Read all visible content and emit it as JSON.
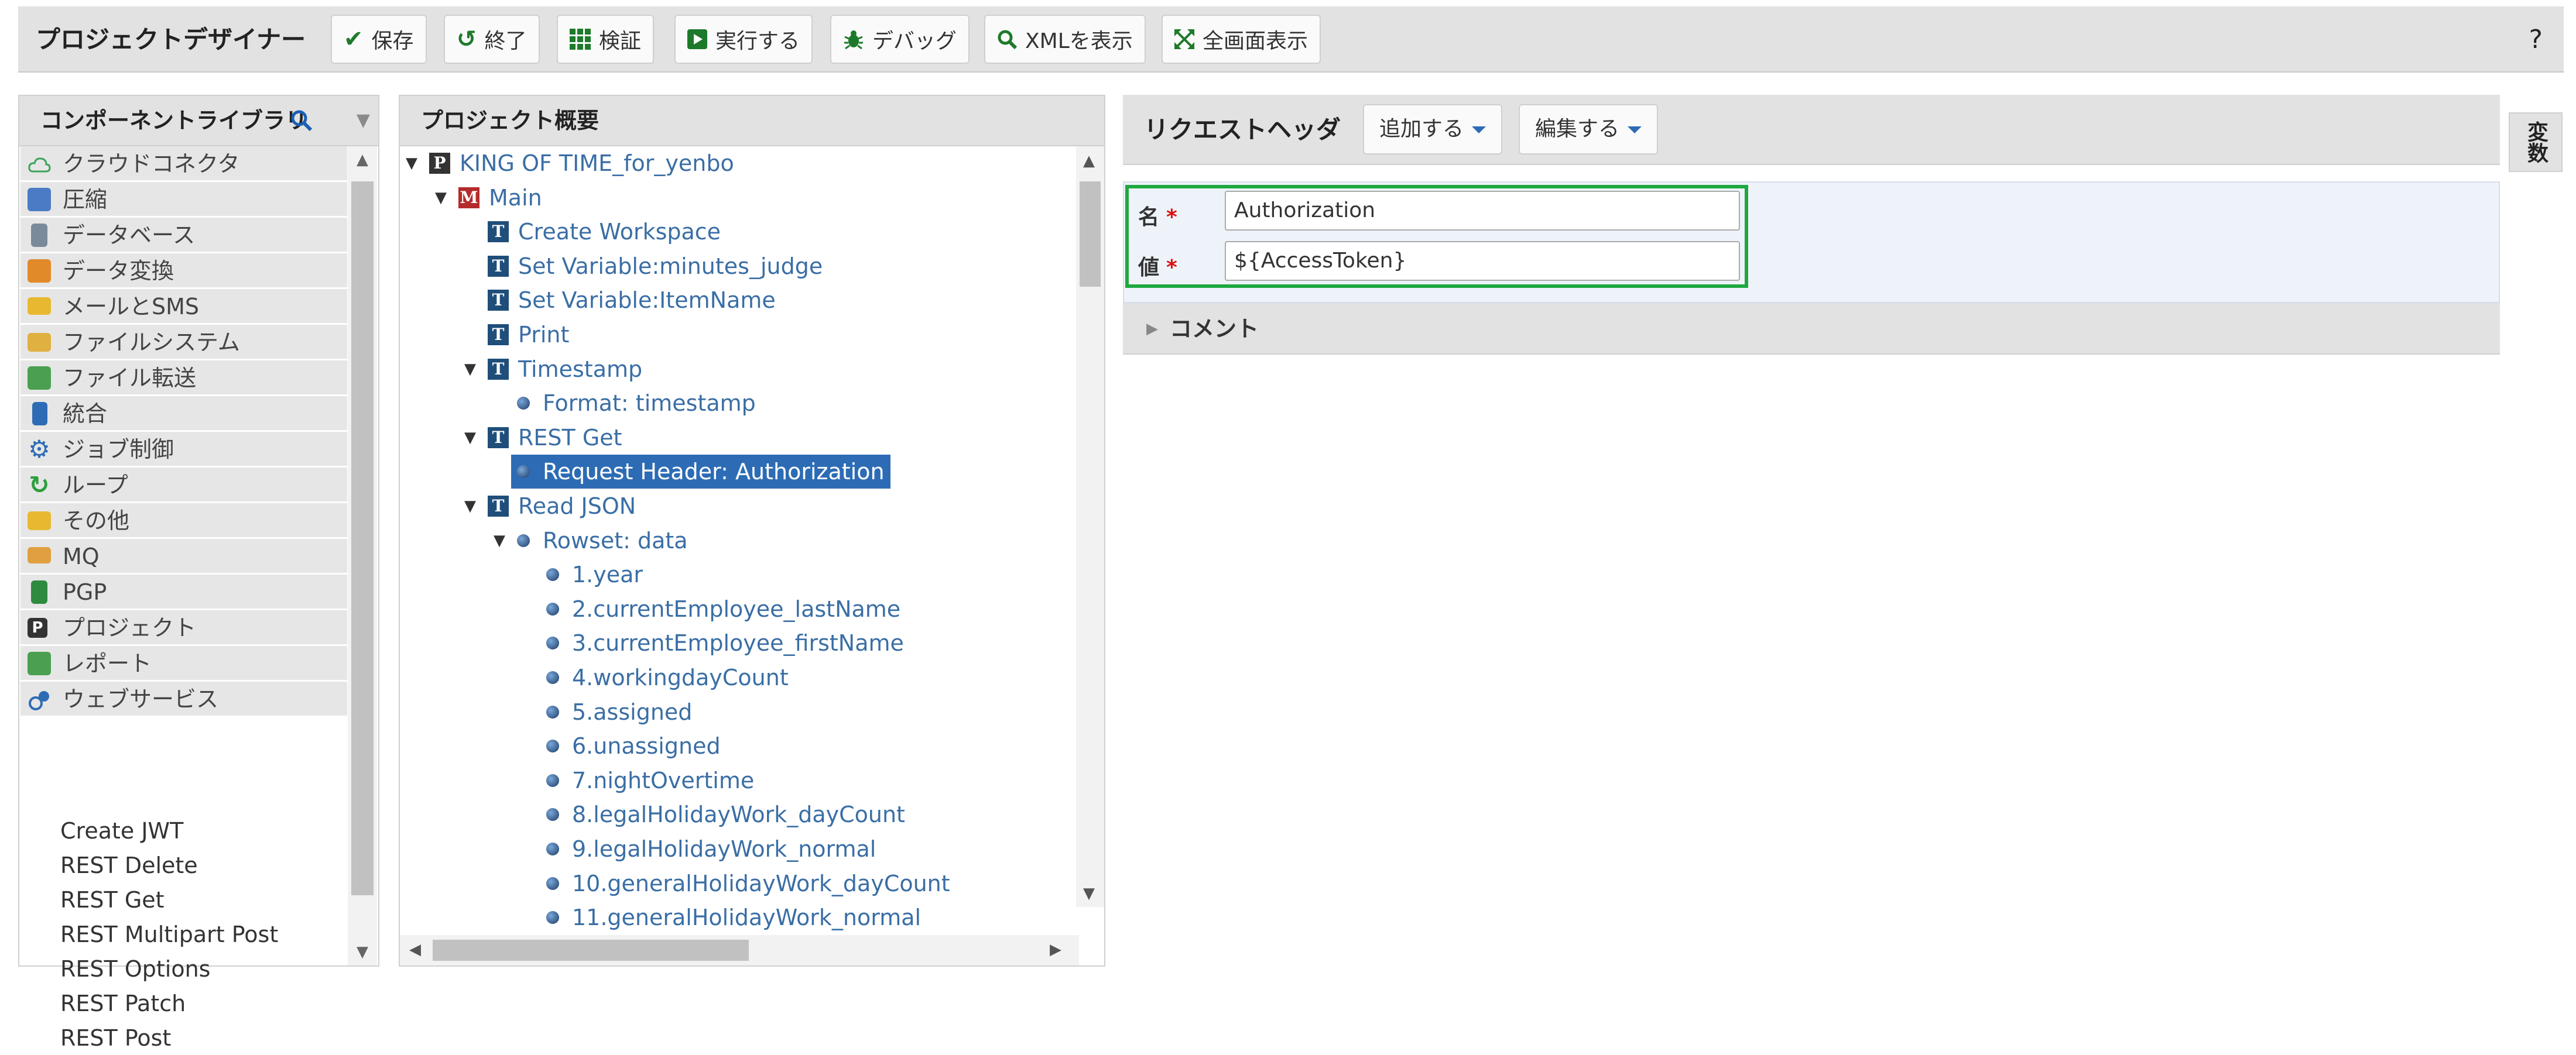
{
  "toolbar": {
    "title": "プロジェクトデザイナー",
    "buttons": [
      {
        "label": "保存",
        "icon": "check-icon"
      },
      {
        "label": "終了",
        "icon": "undo-icon"
      },
      {
        "label": "検証",
        "icon": "grid-icon"
      },
      {
        "label": "実行する",
        "icon": "play-icon"
      },
      {
        "label": "デバッグ",
        "icon": "bug-icon"
      },
      {
        "label": "XMLを表示",
        "icon": "search-icon"
      },
      {
        "label": "全画面表示",
        "icon": "fullscreen-icon"
      }
    ],
    "help": "?"
  },
  "library": {
    "title": "コンポーネントライブラリ",
    "categories": [
      {
        "label": "クラウドコネクタ",
        "icon": "cloud-icon",
        "color": "#3aa55a"
      },
      {
        "label": "圧縮",
        "icon": "compress-icon",
        "color": "#4a7bc4"
      },
      {
        "label": "データベース",
        "icon": "database-icon",
        "color": "#7a8a9a"
      },
      {
        "label": "データ変換",
        "icon": "transform-icon",
        "color": "#e08a2a"
      },
      {
        "label": "メールとSMS",
        "icon": "mail-icon",
        "color": "#e8b830"
      },
      {
        "label": "ファイルシステム",
        "icon": "folder-icon",
        "color": "#e0b040"
      },
      {
        "label": "ファイル転送",
        "icon": "file-transfer-icon",
        "color": "#4aa050"
      },
      {
        "label": "統合",
        "icon": "integration-icon",
        "color": "#2d6cb5"
      },
      {
        "label": "ジョブ制御",
        "icon": "gear-icon",
        "color": "#2d6cb5"
      },
      {
        "label": "ループ",
        "icon": "loop-icon",
        "color": "#2e9e3e"
      },
      {
        "label": "その他",
        "icon": "folder-icon",
        "color": "#e8b830"
      },
      {
        "label": "MQ",
        "icon": "mq-icon",
        "color": "#e0a040"
      },
      {
        "label": "PGP",
        "icon": "lock-icon",
        "color": "#2e8a3e"
      },
      {
        "label": "プロジェクト",
        "icon": "project-icon",
        "color": "#333333"
      },
      {
        "label": "レポート",
        "icon": "report-icon",
        "color": "#4aa050"
      },
      {
        "label": "ウェブサービス",
        "icon": "web-service-icon",
        "color": "#2d6cb5"
      }
    ],
    "items": [
      "Create JWT",
      "REST Delete",
      "REST Get",
      "REST Multipart Post",
      "REST Options",
      "REST Patch",
      "REST Post"
    ]
  },
  "overview": {
    "title": "プロジェクト概要",
    "nodes": [
      {
        "label": "KING OF TIME_for_yenbo",
        "type": "P",
        "indent": 0,
        "expanded": true
      },
      {
        "label": "Main",
        "type": "M",
        "indent": 1,
        "expanded": true
      },
      {
        "label": "Create Workspace",
        "type": "T",
        "indent": 2
      },
      {
        "label": "Set Variable:minutes_judge",
        "type": "T",
        "indent": 2
      },
      {
        "label": "Set Variable:ItemName",
        "type": "T",
        "indent": 2
      },
      {
        "label": "Print",
        "type": "T",
        "indent": 2
      },
      {
        "label": "Timestamp",
        "type": "T",
        "indent": 2,
        "expanded": true
      },
      {
        "label": "Format: timestamp",
        "type": "dot",
        "indent": 3
      },
      {
        "label": "REST Get",
        "type": "T",
        "indent": 2,
        "expanded": true
      },
      {
        "label": "Request Header: Authorization",
        "type": "dot",
        "indent": 3,
        "selected": true
      },
      {
        "label": "Read JSON",
        "type": "T",
        "indent": 2,
        "expanded": true
      },
      {
        "label": "Rowset: data",
        "type": "dot",
        "indent": 3,
        "expanded": true
      },
      {
        "label": "1.year",
        "type": "dot",
        "indent": 4
      },
      {
        "label": "2.currentEmployee_lastName",
        "type": "dot",
        "indent": 4
      },
      {
        "label": "3.currentEmployee_firstName",
        "type": "dot",
        "indent": 4
      },
      {
        "label": "4.workingdayCount",
        "type": "dot",
        "indent": 4
      },
      {
        "label": "5.assigned",
        "type": "dot",
        "indent": 4
      },
      {
        "label": "6.unassigned",
        "type": "dot",
        "indent": 4
      },
      {
        "label": "7.nightOvertime",
        "type": "dot",
        "indent": 4
      },
      {
        "label": "8.legalHolidayWork_dayCount",
        "type": "dot",
        "indent": 4
      },
      {
        "label": "9.legalHolidayWork_normal",
        "type": "dot",
        "indent": 4
      },
      {
        "label": "10.generalHolidayWork_dayCount",
        "type": "dot",
        "indent": 4
      },
      {
        "label": "11.generalHolidayWork_normal",
        "type": "dot",
        "indent": 4
      }
    ]
  },
  "request_header": {
    "title": "リクエストヘッダ",
    "add_label": "追加する",
    "edit_label": "編集する",
    "name_label": "名",
    "value_label": "値",
    "required_mark": "*",
    "name_value": "Authorization",
    "value_value": "${AccessToken}",
    "comment_label": "コメント"
  },
  "variables_tab": "変数",
  "colors": {
    "accent": "#2d6cb5",
    "highlight": "#1fa83f",
    "link": "#3a6ea5"
  }
}
